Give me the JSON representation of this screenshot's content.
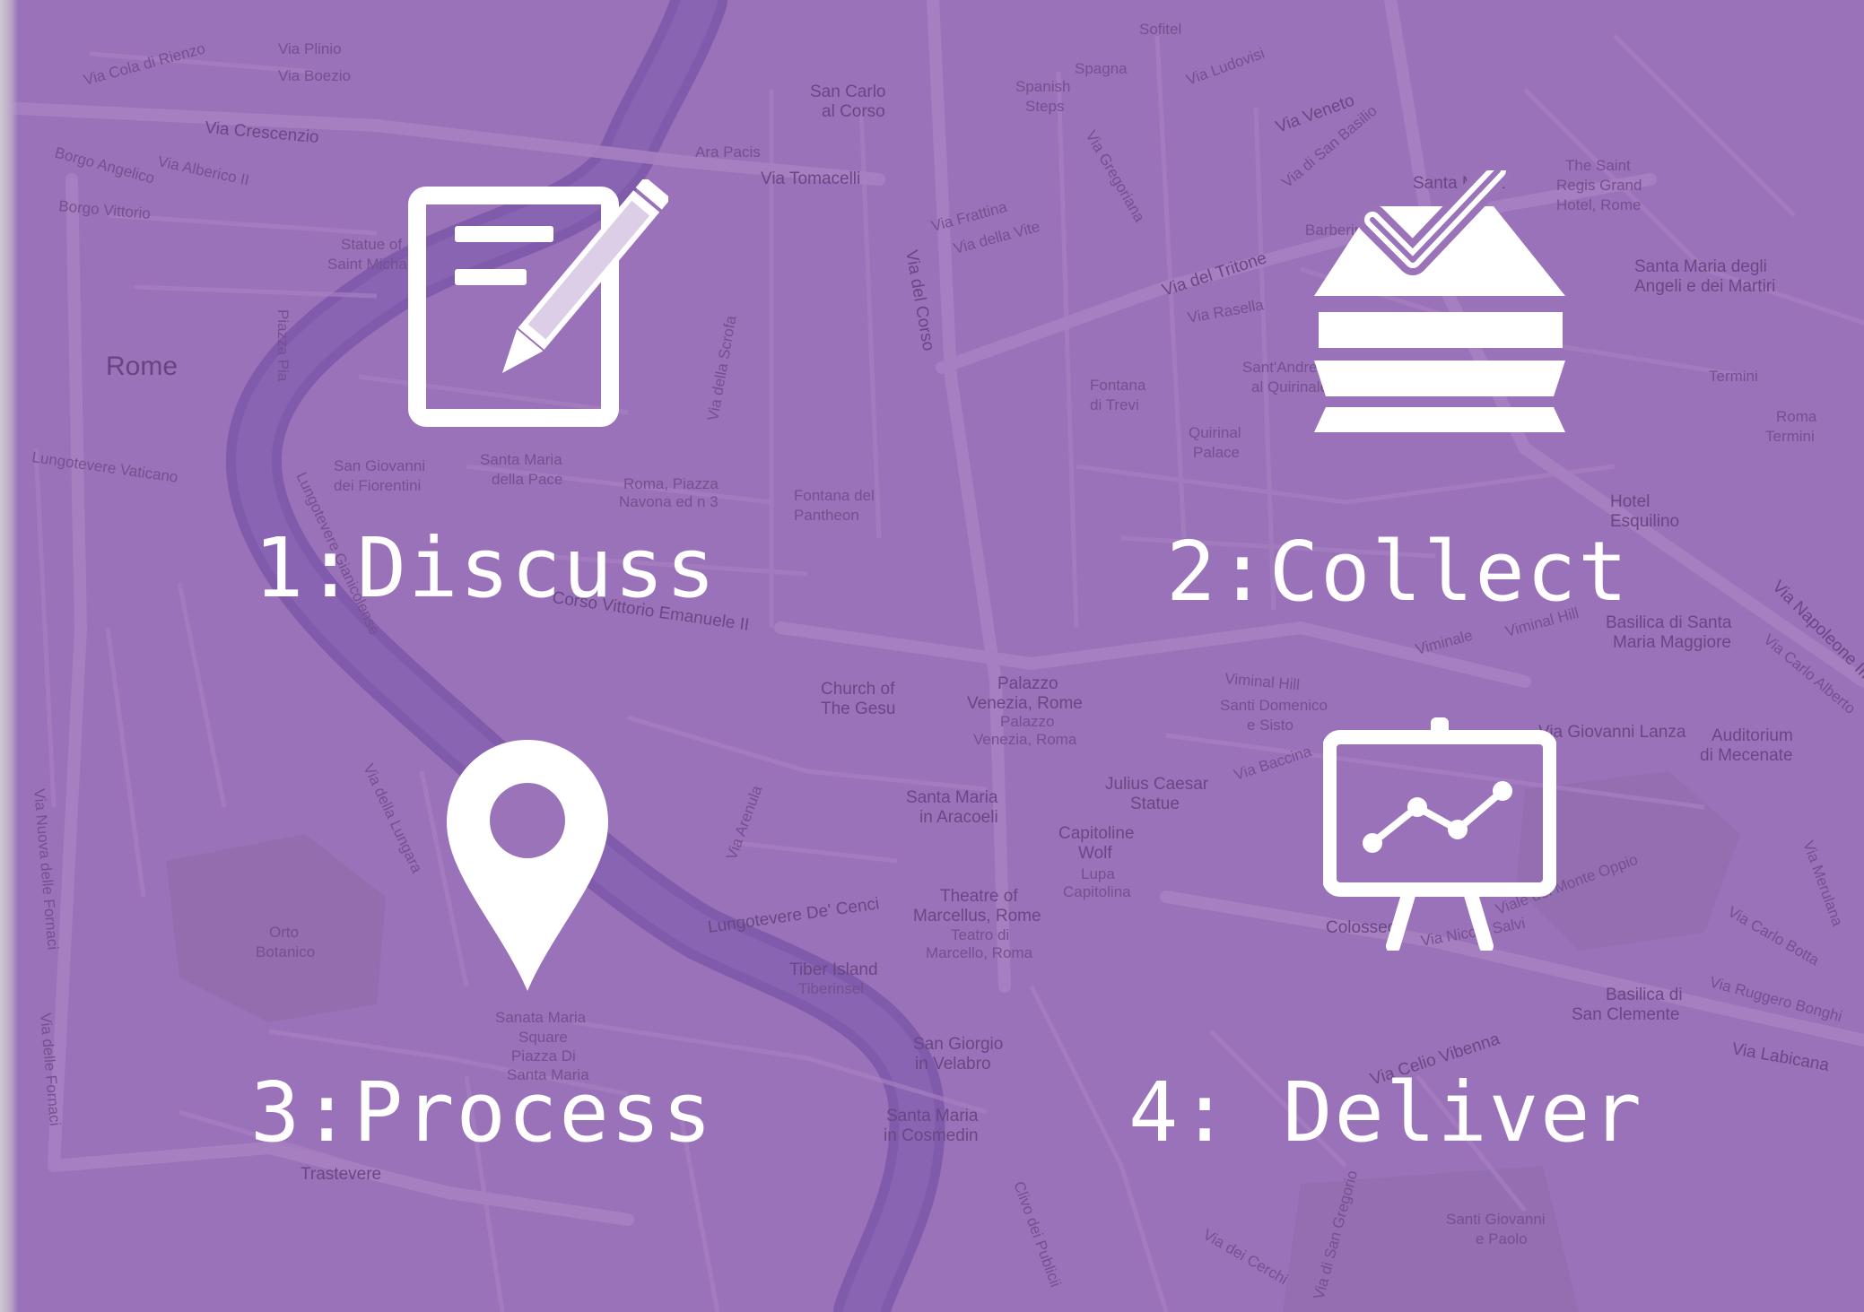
{
  "colors": {
    "background": "#9a73b9",
    "river": "#7c58a8",
    "road": "#b08ac8",
    "foreground": "#ffffff"
  },
  "steps": [
    {
      "label": "1:Discuss",
      "icon": "document-pencil-icon"
    },
    {
      "label": "2:Collect",
      "icon": "layers-check-icon"
    },
    {
      "label": "3:Process",
      "icon": "map-pin-icon"
    },
    {
      "label": "4: Deliver",
      "icon": "presentation-chart-icon"
    }
  ],
  "map_labels": [
    "Via Cola di Rienzo",
    "Via Plinio",
    "Via Boezio",
    "Via Crescenzio",
    "Borgo Angelico",
    "Via Alberico II",
    "Borgo Vittorio",
    "Statue of Saint Michael",
    "Piazza Pia",
    "Rome",
    "Lungotevere Vaticano",
    "San Giovanni dei Fiorentini",
    "Santa Maria della Pace",
    "Roma, Piazza Navona ed n 3",
    "Fontana del Pantheon",
    "Via della Scrofa",
    "San Carlo al Corso",
    "Ara Pacis",
    "Via Tomacelli",
    "Spanish Steps",
    "Spagna",
    "Sofitel",
    "Via Ludovisi",
    "Via Gregoriana",
    "Via Frattina",
    "Via della Vite",
    "Via del Corso",
    "Via Veneto",
    "Via di San Basilio",
    "Santa Maria",
    "Barberini",
    "Via del Tritone",
    "Via Rasella",
    "Fontana di Trevi",
    "Sant'Andrea al Quirinale",
    "Quirinal Palace",
    "The Saint Regis Grand Hotel, Rome",
    "Santa Maria degli Angeli e dei Martiri",
    "Termini",
    "Roma Termini",
    "Hotel Esquilino",
    "Basilica di Santa Maria Maggiore",
    "Via Napoleone III",
    "Via Carlo Alberto",
    "Viminale",
    "Viminal Hill",
    "Santi Domenico e Sisto",
    "Via Baccina",
    "Via Giovanni Lanza",
    "Auditorium di Mecenate",
    "Corso Vittorio Emanuele II",
    "Church of The Gesu",
    "Palazzo Venezia, Rome",
    "Julius Caesar Statue",
    "Santa Maria in Aracoeli",
    "Capitoline Wolf",
    "Theatre of Marcellus, Rome",
    "Lungotevere De' Cenci",
    "Tiber Island",
    "San Giorgio in Velabro",
    "Santa Maria in Cosmedin",
    "Colosseo",
    "Via Celio Vibenna",
    "Basilica di San Clemente",
    "Via Labicana",
    "Santi Giovanni e Paolo",
    "Trastevere",
    "Orto Botanico",
    "Sanata Maria Square Piazza Di Santa Maria",
    "Via della Lungara",
    "Lungotevere Gianicolense",
    "Via Nuova delle Fornaci",
    "Via delle Fornaci",
    "Viale del Monte Oppio",
    "Via Merulana",
    "Via Carlo Botta",
    "Via Ruggero Bonghi",
    "Via di San Gregorio",
    "Via dei Cerchi",
    "Clivo dei Publicii",
    "Via Arenula"
  ]
}
